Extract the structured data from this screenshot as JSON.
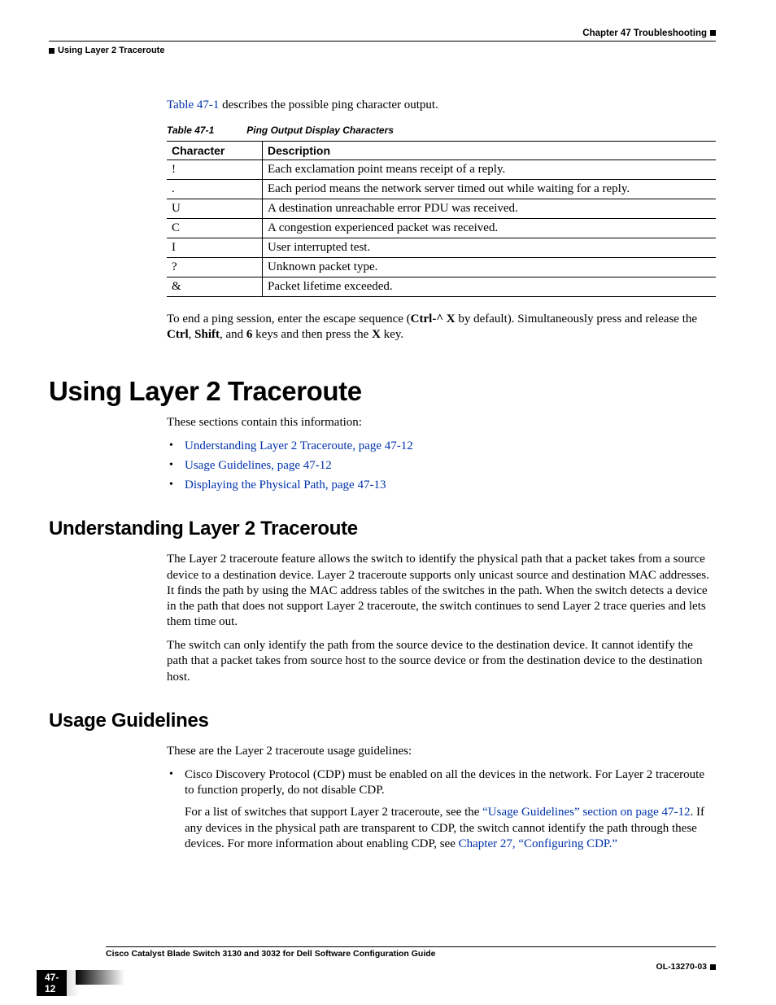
{
  "header": {
    "chapter": "Chapter 47    Troubleshooting",
    "section": "Using Layer 2 Traceroute"
  },
  "intro_ref": "Table 47-1",
  "intro_text_after": " describes the possible ping character output.",
  "table": {
    "caption_num": "Table 47-1",
    "caption_title": "Ping Output Display Characters",
    "headers": [
      "Character",
      "Description"
    ],
    "rows": [
      [
        "!",
        "Each exclamation point means receipt of a reply."
      ],
      [
        ".",
        "Each period means the network server timed out while waiting for a reply."
      ],
      [
        "U",
        "A destination unreachable error PDU was received."
      ],
      [
        "C",
        "A congestion experienced packet was received."
      ],
      [
        "I",
        "User interrupted test."
      ],
      [
        "?",
        "Unknown packet type."
      ],
      [
        "&",
        "Packet lifetime exceeded."
      ]
    ]
  },
  "end_ping": {
    "pre": "To end a ping session, enter the escape sequence (",
    "ctrlx": "Ctrl-^ X",
    "mid": " by default). Simultaneously press and release the ",
    "k1": "Ctrl",
    "c1": ", ",
    "k2": "Shift",
    "c2": ", and ",
    "k3": "6",
    "mid2": " keys and then press the ",
    "k4": "X",
    "post": " key."
  },
  "h1": "Using Layer 2 Traceroute",
  "h1_intro": "These sections contain this information:",
  "h1_links": [
    "Understanding Layer 2 Traceroute, page 47-12",
    "Usage Guidelines, page 47-12",
    "Displaying the Physical Path, page 47-13"
  ],
  "h2a": "Understanding Layer 2 Traceroute",
  "h2a_p1": "The Layer 2 traceroute feature allows the switch to identify the physical path that a packet takes from a source device to a destination device. Layer 2 traceroute supports only unicast source and destination MAC addresses. It finds the path by using the MAC address tables of the switches in the path. When the switch detects a device in the path that does not support Layer 2 traceroute, the switch continues to send Layer 2 trace queries and lets them time out.",
  "h2a_p2": "The switch can only identify the path from the source device to the destination device. It cannot identify the path that a packet takes from source host to the source device or from the destination device to the destination host.",
  "h2b": "Usage Guidelines",
  "h2b_intro": "These are the Layer 2 traceroute usage guidelines:",
  "h2b_b1": "Cisco Discovery Protocol (CDP) must be enabled on all the devices in the network. For Layer 2 traceroute to function properly, do not disable CDP.",
  "h2b_sub_pre": "For a list of switches that support Layer 2 traceroute, see the ",
  "h2b_sub_l1": "“Usage Guidelines” section on page 47-12",
  "h2b_sub_mid": ". If any devices in the physical path are transparent to CDP, the switch cannot identify the path through these devices. For more information about enabling CDP, see ",
  "h2b_sub_l2": "Chapter 27, “Configuring CDP.”",
  "footer": {
    "title": "Cisco Catalyst Blade Switch 3130 and 3032 for Dell Software Configuration Guide",
    "page": "47-12",
    "docid": "OL-13270-03"
  }
}
